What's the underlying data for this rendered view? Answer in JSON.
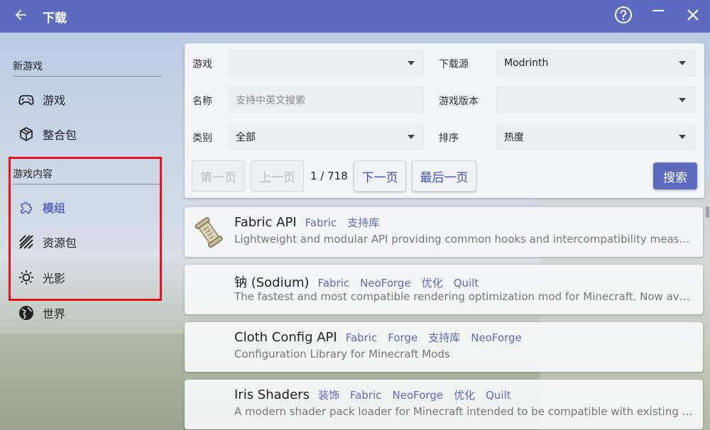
{
  "titlebar": {
    "title": "下载",
    "icons": {
      "back": "arrow-left-icon",
      "help": "help-circle-icon",
      "minimize": "minimize-icon",
      "close": "close-icon"
    }
  },
  "sidebar": {
    "section_new": "新游戏",
    "new_items": [
      {
        "label": "游戏",
        "icon": "gamepad-icon"
      },
      {
        "label": "整合包",
        "icon": "package-icon"
      }
    ],
    "section_content": "游戏内容",
    "content_items": [
      {
        "label": "模组",
        "icon": "puzzle-icon",
        "active": true
      },
      {
        "label": "资源包",
        "icon": "texture-icon"
      },
      {
        "label": "光影",
        "icon": "sun-icon"
      },
      {
        "label": "世界",
        "icon": "globe-icon"
      }
    ]
  },
  "filter": {
    "game_label": "游戏",
    "game_value": "",
    "source_label": "下载源",
    "source_value": "Modrinth",
    "name_label": "名称",
    "name_placeholder": "支持中英文搜索",
    "version_label": "游戏版本",
    "version_value": "",
    "category_label": "类别",
    "category_value": "全部",
    "sort_label": "排序",
    "sort_value": "热度"
  },
  "pagination": {
    "first": "第一页",
    "prev": "上一页",
    "info": "1 / 718",
    "next": "下一页",
    "last": "最后一页",
    "search": "搜索"
  },
  "results": [
    {
      "name": "Fabric API",
      "tags": [
        "Fabric",
        "支持库"
      ],
      "description": "Lightweight and modular API providing common hooks and intercompatibility measures ...",
      "icon": "scroll-icon"
    },
    {
      "name": "钠 (Sodium)",
      "tags": [
        "Fabric",
        "NeoForge",
        "优化",
        "Quilt"
      ],
      "description": "The fastest and most compatible rendering optimization mod for Minecraft. Now availab...",
      "icon": ""
    },
    {
      "name": "Cloth Config API",
      "tags": [
        "Fabric",
        "Forge",
        "支持库",
        "NeoForge"
      ],
      "description": "Configuration Library for Minecraft Mods",
      "icon": ""
    },
    {
      "name": "Iris Shaders",
      "tags": [
        "装饰",
        "Fabric",
        "NeoForge",
        "优化",
        "Quilt"
      ],
      "description": "A modern shader pack loader for Minecraft intended to be compatible with existing Opti...",
      "icon": ""
    }
  ],
  "colors": {
    "accent": "#5c6bc0",
    "highlight": "#e8131a"
  }
}
